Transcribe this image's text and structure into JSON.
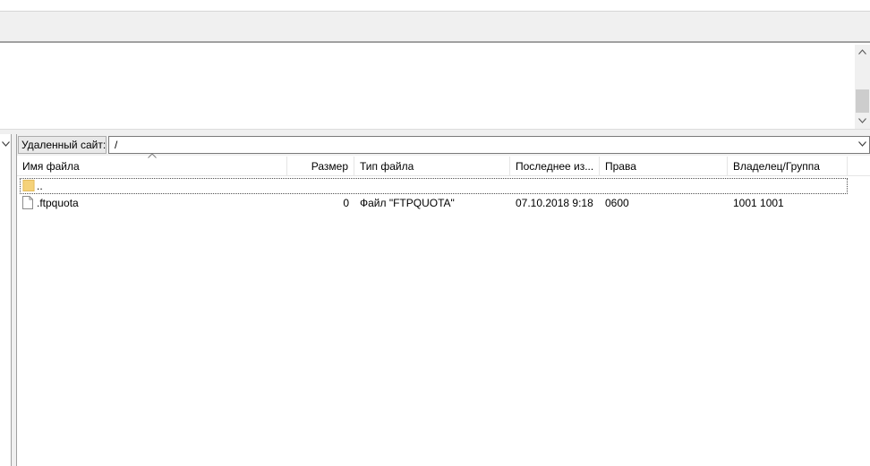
{
  "remote": {
    "site_label": "Удаленный сайт:",
    "path": "/"
  },
  "columns": {
    "name": "Имя файла",
    "size": "Размер",
    "type": "Тип файла",
    "modified": "Последнее из...",
    "perms": "Права",
    "owner": "Владелец/Группа"
  },
  "rows": [
    {
      "name": "..",
      "size": "",
      "type": "",
      "modified": "",
      "perms": "",
      "owner": "",
      "icon": "folder-icon"
    },
    {
      "name": ".ftpquota",
      "size": "0",
      "type": "Файл \"FTPQUOTA\"",
      "modified": "07.10.2018 9:18",
      "perms": "0600",
      "owner": "1001 1001",
      "icon": "file-icon"
    }
  ],
  "colors": {
    "folder": "#f5d27a",
    "toolbar_bg": "#f0f0f0",
    "border": "#a0a0a0"
  }
}
